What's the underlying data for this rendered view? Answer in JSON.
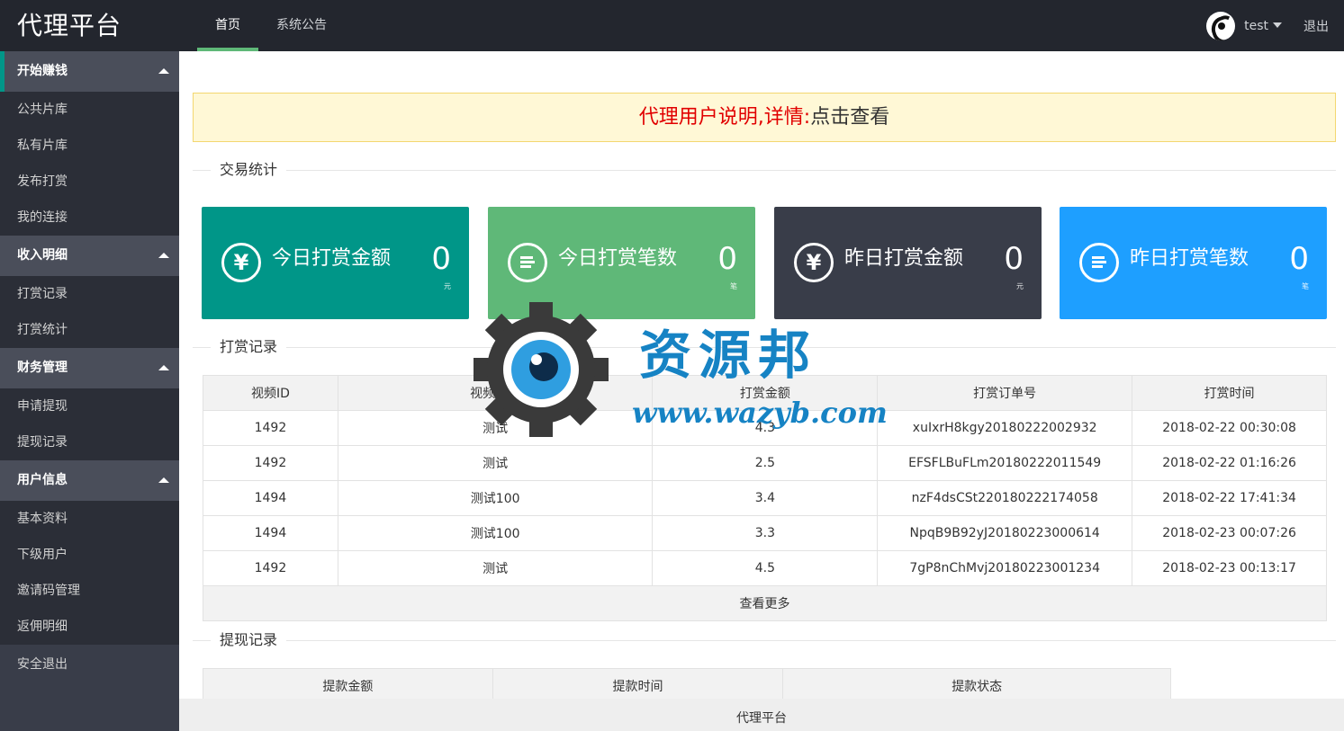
{
  "header": {
    "logo": "代理平台",
    "nav": [
      {
        "label": "首页",
        "active": true
      },
      {
        "label": "系统公告",
        "active": false
      }
    ],
    "username": "test",
    "logout": "退出"
  },
  "sidebar": {
    "groups": [
      {
        "title": "开始赚钱",
        "items": [
          "公共片库",
          "私有片库",
          "发布打赏",
          "我的连接"
        ]
      },
      {
        "title": "收入明细",
        "items": [
          "打赏记录",
          "打赏统计"
        ]
      },
      {
        "title": "财务管理",
        "items": [
          "申请提现",
          "提现记录"
        ]
      },
      {
        "title": "用户信息",
        "items": [
          "基本资料",
          "下级用户",
          "邀请码管理",
          "返佣明细"
        ]
      }
    ],
    "exit": "安全退出"
  },
  "notice": {
    "text": "代理用户说明,详情:",
    "link": "点击查看"
  },
  "sections": {
    "stats": "交易统计",
    "records": "打赏记录",
    "withdraw": "提现记录"
  },
  "cards": [
    {
      "label": "今日打赏金额",
      "value": "0",
      "unit": "元",
      "icon": "yen-icon",
      "color": "#009688"
    },
    {
      "label": "今日打赏笔数",
      "value": "0",
      "unit": "笔",
      "icon": "list-icon",
      "color": "#5fb878"
    },
    {
      "label": "昨日打赏金额",
      "value": "0",
      "unit": "元",
      "icon": "yen-icon",
      "color": "#393d49"
    },
    {
      "label": "昨日打赏笔数",
      "value": "0",
      "unit": "笔",
      "icon": "list-icon",
      "color": "#1e9fff"
    }
  ],
  "records_table": {
    "headers": [
      "视频ID",
      "视频名称",
      "打赏金额",
      "打赏订单号",
      "打赏时间"
    ],
    "rows": [
      [
        "1492",
        "测试",
        "4.3",
        "xuIxrH8kgy20180222002932",
        "2018-02-22 00:30:08"
      ],
      [
        "1492",
        "测试",
        "2.5",
        "EFSFLBuFLm20180222011549",
        "2018-02-22 01:16:26"
      ],
      [
        "1494",
        "测试100",
        "3.4",
        "nzF4dsCSt220180222174058",
        "2018-02-22 17:41:34"
      ],
      [
        "1494",
        "测试100",
        "3.3",
        "NpqB9B92yJ20180223000614",
        "2018-02-23 00:07:26"
      ],
      [
        "1492",
        "测试",
        "4.5",
        "7gP8nChMvj20180223001234",
        "2018-02-23 00:13:17"
      ]
    ],
    "more": "查看更多"
  },
  "withdraw_table": {
    "headers": [
      "提款金额",
      "提款时间",
      "提款状态"
    ]
  },
  "footer": "代理平台",
  "watermark": {
    "title": "资源邦",
    "url": "www.wazyb.com"
  }
}
